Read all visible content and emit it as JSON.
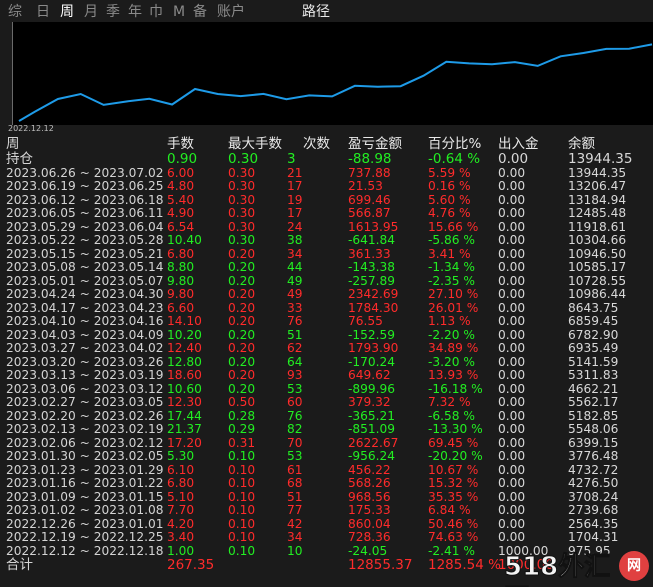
{
  "tabs": [
    {
      "label": "综",
      "active": false
    },
    {
      "label": "日",
      "active": false
    },
    {
      "label": "周",
      "active": true
    },
    {
      "label": "月",
      "active": false
    },
    {
      "label": "季",
      "active": false
    },
    {
      "label": "年",
      "active": false
    },
    {
      "label": "巾",
      "active": false
    },
    {
      "label": "M",
      "active": false
    },
    {
      "label": "备",
      "active": false
    },
    {
      "label": "账户",
      "active": false
    },
    {
      "label": "路径",
      "active": false
    }
  ],
  "chart": {
    "start_date": "2022.12.12",
    "line_color": "#1e9be8",
    "equity": [
      2564.35,
      4701.91,
      5548.06,
      3708.24,
      4276.5,
      4732.72,
      3776.48,
      6399.15,
      5548.06,
      5182.85,
      5562.17,
      4662.21,
      5311.83,
      5141.59,
      6935.49,
      6782.9,
      6859.45,
      8643.75,
      10986.44,
      10728.55,
      10585.17,
      10946.5,
      10304.66,
      11918.61,
      12485.48,
      13184.94,
      13206.47,
      13944.35
    ]
  },
  "table": {
    "headers": {
      "week": "周",
      "lots": "手数",
      "max_lots": "最大手数",
      "count": "次数",
      "pnl": "盈亏金额",
      "percent": "百分比%",
      "deposit": "出入金",
      "balance": "余额"
    },
    "position_row": {
      "label": "持仓",
      "lots": "0.90",
      "max_lots": "0.30",
      "count": "3",
      "pnl": "-88.98",
      "percent": "-0.64 %",
      "deposit": "0.00",
      "balance": "13944.35",
      "sign": "neg"
    },
    "rows": [
      {
        "week": "2023.06.26 ~ 2023.07.02",
        "lots": "6.00",
        "max_lots": "0.30",
        "count": "21",
        "pnl": "737.88",
        "percent": "5.59 %",
        "deposit": "0.00",
        "balance": "13944.35",
        "sign": "pos"
      },
      {
        "week": "2023.06.19 ~ 2023.06.25",
        "lots": "4.80",
        "max_lots": "0.30",
        "count": "17",
        "pnl": "21.53",
        "percent": "0.16 %",
        "deposit": "0.00",
        "balance": "13206.47",
        "sign": "pos"
      },
      {
        "week": "2023.06.12 ~ 2023.06.18",
        "lots": "5.40",
        "max_lots": "0.30",
        "count": "19",
        "pnl": "699.46",
        "percent": "5.60 %",
        "deposit": "0.00",
        "balance": "13184.94",
        "sign": "pos"
      },
      {
        "week": "2023.06.05 ~ 2023.06.11",
        "lots": "4.90",
        "max_lots": "0.30",
        "count": "17",
        "pnl": "566.87",
        "percent": "4.76 %",
        "deposit": "0.00",
        "balance": "12485.48",
        "sign": "pos"
      },
      {
        "week": "2023.05.29 ~ 2023.06.04",
        "lots": "6.54",
        "max_lots": "0.30",
        "count": "24",
        "pnl": "1613.95",
        "percent": "15.66 %",
        "deposit": "0.00",
        "balance": "11918.61",
        "sign": "pos"
      },
      {
        "week": "2023.05.22 ~ 2023.05.28",
        "lots": "10.40",
        "max_lots": "0.30",
        "count": "38",
        "pnl": "-641.84",
        "percent": "-5.86 %",
        "deposit": "0.00",
        "balance": "10304.66",
        "sign": "neg"
      },
      {
        "week": "2023.05.15 ~ 2023.05.21",
        "lots": "6.80",
        "max_lots": "0.20",
        "count": "34",
        "pnl": "361.33",
        "percent": "3.41 %",
        "deposit": "0.00",
        "balance": "10946.50",
        "sign": "pos"
      },
      {
        "week": "2023.05.08 ~ 2023.05.14",
        "lots": "8.80",
        "max_lots": "0.20",
        "count": "44",
        "pnl": "-143.38",
        "percent": "-1.34 %",
        "deposit": "0.00",
        "balance": "10585.17",
        "sign": "neg"
      },
      {
        "week": "2023.05.01 ~ 2023.05.07",
        "lots": "9.80",
        "max_lots": "0.20",
        "count": "49",
        "pnl": "-257.89",
        "percent": "-2.35 %",
        "deposit": "0.00",
        "balance": "10728.55",
        "sign": "neg"
      },
      {
        "week": "2023.04.24 ~ 2023.04.30",
        "lots": "9.80",
        "max_lots": "0.20",
        "count": "49",
        "pnl": "2342.69",
        "percent": "27.10 %",
        "deposit": "0.00",
        "balance": "10986.44",
        "sign": "pos"
      },
      {
        "week": "2023.04.17 ~ 2023.04.23",
        "lots": "6.60",
        "max_lots": "0.20",
        "count": "33",
        "pnl": "1784.30",
        "percent": "26.01 %",
        "deposit": "0.00",
        "balance": "8643.75",
        "sign": "pos"
      },
      {
        "week": "2023.04.10 ~ 2023.04.16",
        "lots": "14.10",
        "max_lots": "0.20",
        "count": "76",
        "pnl": "76.55",
        "percent": "1.13 %",
        "deposit": "0.00",
        "balance": "6859.45",
        "sign": "pos"
      },
      {
        "week": "2023.04.03 ~ 2023.04.09",
        "lots": "10.20",
        "max_lots": "0.20",
        "count": "51",
        "pnl": "-152.59",
        "percent": "-2.20 %",
        "deposit": "0.00",
        "balance": "6782.90",
        "sign": "neg"
      },
      {
        "week": "2023.03.27 ~ 2023.04.02",
        "lots": "12.40",
        "max_lots": "0.20",
        "count": "62",
        "pnl": "1793.90",
        "percent": "34.89 %",
        "deposit": "0.00",
        "balance": "6935.49",
        "sign": "pos"
      },
      {
        "week": "2023.03.20 ~ 2023.03.26",
        "lots": "12.80",
        "max_lots": "0.20",
        "count": "64",
        "pnl": "-170.24",
        "percent": "-3.20 %",
        "deposit": "0.00",
        "balance": "5141.59",
        "sign": "neg"
      },
      {
        "week": "2023.03.13 ~ 2023.03.19",
        "lots": "18.60",
        "max_lots": "0.20",
        "count": "93",
        "pnl": "649.62",
        "percent": "13.93 %",
        "deposit": "0.00",
        "balance": "5311.83",
        "sign": "pos"
      },
      {
        "week": "2023.03.06 ~ 2023.03.12",
        "lots": "10.60",
        "max_lots": "0.20",
        "count": "53",
        "pnl": "-899.96",
        "percent": "-16.18 %",
        "deposit": "0.00",
        "balance": "4662.21",
        "sign": "neg"
      },
      {
        "week": "2023.02.27 ~ 2023.03.05",
        "lots": "12.30",
        "max_lots": "0.50",
        "count": "60",
        "pnl": "379.32",
        "percent": "7.32 %",
        "deposit": "0.00",
        "balance": "5562.17",
        "sign": "pos"
      },
      {
        "week": "2023.02.20 ~ 2023.02.26",
        "lots": "17.44",
        "max_lots": "0.28",
        "count": "76",
        "pnl": "-365.21",
        "percent": "-6.58 %",
        "deposit": "0.00",
        "balance": "5182.85",
        "sign": "neg"
      },
      {
        "week": "2023.02.13 ~ 2023.02.19",
        "lots": "21.37",
        "max_lots": "0.29",
        "count": "82",
        "pnl": "-851.09",
        "percent": "-13.30 %",
        "deposit": "0.00",
        "balance": "5548.06",
        "sign": "neg"
      },
      {
        "week": "2023.02.06 ~ 2023.02.12",
        "lots": "17.20",
        "max_lots": "0.31",
        "count": "70",
        "pnl": "2622.67",
        "percent": "69.45 %",
        "deposit": "0.00",
        "balance": "6399.15",
        "sign": "pos"
      },
      {
        "week": "2023.01.30 ~ 2023.02.05",
        "lots": "5.30",
        "max_lots": "0.10",
        "count": "53",
        "pnl": "-956.24",
        "percent": "-20.20 %",
        "deposit": "0.00",
        "balance": "3776.48",
        "sign": "neg"
      },
      {
        "week": "2023.01.23 ~ 2023.01.29",
        "lots": "6.10",
        "max_lots": "0.10",
        "count": "61",
        "pnl": "456.22",
        "percent": "10.67 %",
        "deposit": "0.00",
        "balance": "4732.72",
        "sign": "pos"
      },
      {
        "week": "2023.01.16 ~ 2023.01.22",
        "lots": "6.80",
        "max_lots": "0.10",
        "count": "68",
        "pnl": "568.26",
        "percent": "15.32 %",
        "deposit": "0.00",
        "balance": "4276.50",
        "sign": "pos"
      },
      {
        "week": "2023.01.09 ~ 2023.01.15",
        "lots": "5.10",
        "max_lots": "0.10",
        "count": "51",
        "pnl": "968.56",
        "percent": "35.35 %",
        "deposit": "0.00",
        "balance": "3708.24",
        "sign": "pos"
      },
      {
        "week": "2023.01.02 ~ 2023.01.08",
        "lots": "7.70",
        "max_lots": "0.10",
        "count": "77",
        "pnl": "175.33",
        "percent": "6.84 %",
        "deposit": "0.00",
        "balance": "2739.68",
        "sign": "pos"
      },
      {
        "week": "2022.12.26 ~ 2023.01.01",
        "lots": "4.20",
        "max_lots": "0.10",
        "count": "42",
        "pnl": "860.04",
        "percent": "50.46 %",
        "deposit": "0.00",
        "balance": "2564.35",
        "sign": "pos"
      },
      {
        "week": "2022.12.19 ~ 2022.12.25",
        "lots": "3.40",
        "max_lots": "0.10",
        "count": "34",
        "pnl": "728.36",
        "percent": "74.63 %",
        "deposit": "0.00",
        "balance": "1704.31",
        "sign": "pos"
      },
      {
        "week": "2022.12.12 ~ 2022.12.18",
        "lots": "1.00",
        "max_lots": "0.10",
        "count": "10",
        "pnl": "-24.05",
        "percent": "-2.41 %",
        "deposit": "1000.00",
        "balance": "975.95",
        "sign": "neg"
      }
    ],
    "total_row": {
      "label": "合计",
      "lots": "267.35",
      "pnl": "12855.37",
      "percent": "1285.54 %",
      "deposit": "1000.00",
      "sign": "pos"
    }
  },
  "watermark": {
    "text": "518外汇网",
    "badge": "网"
  },
  "colors": {
    "positive": "#ff2b2b",
    "negative": "#22ee22",
    "background": "#1b1b1b",
    "chart_bg": "#000000",
    "line": "#1e9be8"
  }
}
